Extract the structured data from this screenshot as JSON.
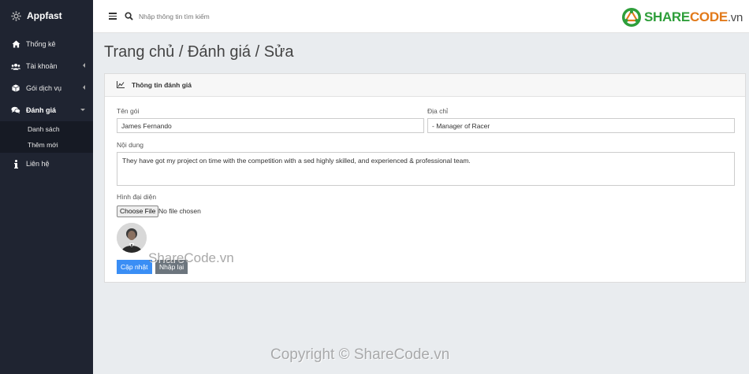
{
  "app": {
    "name": "Appfast"
  },
  "sidebar": {
    "items": [
      {
        "label": "Thống kê",
        "icon": "home-icon"
      },
      {
        "label": "Tài khoản",
        "icon": "users-icon"
      },
      {
        "label": "Gói dịch vụ",
        "icon": "box-icon"
      },
      {
        "label": "Đánh giá",
        "icon": "comments-icon",
        "active": true,
        "children": [
          {
            "label": "Danh sách"
          },
          {
            "label": "Thêm mới"
          }
        ]
      },
      {
        "label": "Liên hệ",
        "icon": "info-icon"
      }
    ]
  },
  "topbar": {
    "search_placeholder": "Nhập thông tin tìm kiếm"
  },
  "logo": {
    "part1": "SHARE",
    "part2": "CODE",
    "part3": ".vn"
  },
  "page": {
    "title": "Trang chủ / Đánh giá / Sửa"
  },
  "card": {
    "header": "Thông tin đánh giá",
    "fields": {
      "name": {
        "label": "Tên gói",
        "value": "James Fernando"
      },
      "address": {
        "label": "Địa chỉ",
        "value": "- Manager of Racer"
      },
      "content": {
        "label": "Nội dung",
        "value": "They have got my project on time with the competition with a sed highly skilled, and experienced & professional team."
      },
      "avatar": {
        "label": "Hình đại diện",
        "file_button": "Choose File",
        "file_status": "No file chosen"
      }
    },
    "buttons": {
      "submit": "Cập nhật",
      "reset": "Nhập lại"
    }
  },
  "watermarks": {
    "center": "ShareCode.vn",
    "footer": "Copyright © ShareCode.vn"
  },
  "colors": {
    "sidebar": "#1f2431",
    "primary": "#3a8ef5",
    "secondary": "#6c757d",
    "brand_green": "#2e9e3a",
    "brand_orange": "#e27a1b"
  }
}
